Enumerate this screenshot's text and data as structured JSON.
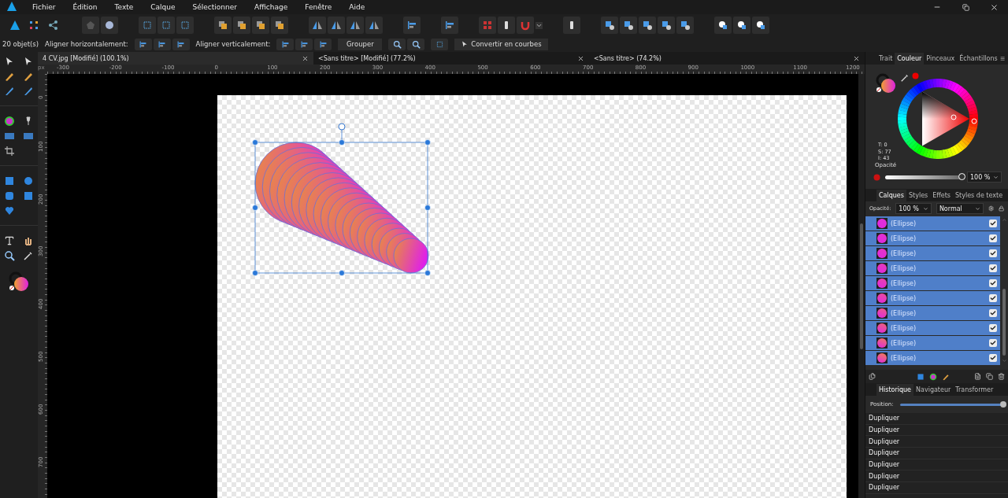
{
  "menu": [
    "Fichier",
    "Édition",
    "Texte",
    "Calque",
    "Sélectionner",
    "Affichage",
    "Fenêtre",
    "Aide"
  ],
  "context_bar": {
    "selection_count": "20 objet(s)",
    "align_h_label": "Aligner horizontalement:",
    "align_v_label": "Aligner verticalement:",
    "group_button": "Grouper",
    "convert_button": "Convertir en courbes"
  },
  "document_tabs": [
    {
      "title": "4 CV.jpg [Modifié] (100.1%)",
      "selected": true
    },
    {
      "title": "<Sans titre> [Modifié] (77.2%)",
      "selected": false
    },
    {
      "title": "<Sans titre> (74.2%)",
      "selected": false
    }
  ],
  "rulers": {
    "unit": "px",
    "horizontal": [
      "-300",
      "-200",
      "-100",
      "0",
      "100",
      "200",
      "300",
      "400",
      "500",
      "600",
      "700",
      "800",
      "900",
      "1000",
      "1100",
      "1200"
    ],
    "vertical": [
      "0",
      "100",
      "200",
      "300",
      "400",
      "500",
      "600",
      "700"
    ]
  },
  "color_panel": {
    "tabs": [
      {
        "label": "Trait",
        "selected": false
      },
      {
        "label": "Couleur",
        "selected": true
      },
      {
        "label": "Pinceaux",
        "selected": false
      },
      {
        "label": "Échantillons",
        "selected": false
      }
    ],
    "readouts": [
      "T: 0",
      "S: 77",
      "I: 43"
    ],
    "opacity_label": "Opacité",
    "opacity": {
      "level": 1,
      "value": "100 %"
    }
  },
  "layers_panel": {
    "tabs": [
      {
        "label": "Calques",
        "selected": true
      },
      {
        "label": "Styles",
        "selected": false
      },
      {
        "label": "Effets",
        "selected": false
      },
      {
        "label": "Styles de texte",
        "selected": false
      }
    ],
    "opacity_label": "Opacité:",
    "opacity_value": "100 %",
    "blend_mode": "Normal",
    "layers": [
      {
        "name": "(Ellipse)",
        "selected": true,
        "visible": true
      },
      {
        "name": "(Ellipse)",
        "selected": true,
        "visible": true
      },
      {
        "name": "(Ellipse)",
        "selected": true,
        "visible": true
      },
      {
        "name": "(Ellipse)",
        "selected": true,
        "visible": true
      },
      {
        "name": "(Ellipse)",
        "selected": true,
        "visible": true
      },
      {
        "name": "(Ellipse)",
        "selected": true,
        "visible": true
      },
      {
        "name": "(Ellipse)",
        "selected": true,
        "visible": true
      },
      {
        "name": "(Ellipse)",
        "selected": true,
        "visible": true
      },
      {
        "name": "(Ellipse)",
        "selected": true,
        "visible": true
      },
      {
        "name": "(Ellipse)",
        "selected": true,
        "visible": true
      }
    ]
  },
  "history_panel": {
    "tabs": [
      {
        "label": "Historique",
        "selected": true
      },
      {
        "label": "Navigateur",
        "selected": false
      },
      {
        "label": "Transformer",
        "selected": false
      }
    ],
    "position_label": "Position:",
    "position": {
      "level": 1
    },
    "entries": [
      "Dupliquer",
      "Dupliquer",
      "Dupliquer",
      "Dupliquer",
      "Dupliquer",
      "Dupliquer",
      "Dupliquer"
    ]
  }
}
